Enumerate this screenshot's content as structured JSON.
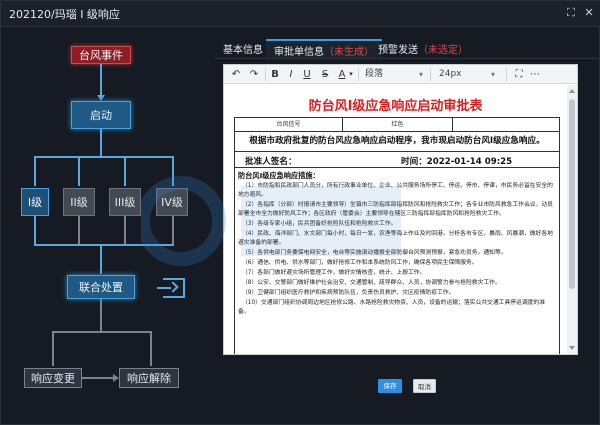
{
  "window": {
    "title": "202120/玛瑙 I 级响应"
  },
  "flow": {
    "event": "台风事件",
    "start": "启动",
    "levels": [
      "I级",
      "II级",
      "III级",
      "IV级"
    ],
    "joint": "联合处置",
    "change": "响应变更",
    "release": "响应解除"
  },
  "tabs": [
    {
      "label": "基本信息",
      "suffix": ""
    },
    {
      "label": "审批单信息",
      "suffix": "（未生成）"
    },
    {
      "label": "预警发送",
      "suffix": "（未选定）"
    }
  ],
  "toolbar": {
    "undo": "↶",
    "redo": "↷",
    "bold": "B",
    "italic": "I",
    "underline": "U",
    "strike": "S",
    "color": "A",
    "paragraph": "段落",
    "fontsize": "24px"
  },
  "doc": {
    "title": "防台风Ⅰ级应急响应启动审批表",
    "level_label": "台风信号",
    "level_value": "红色",
    "request_text": "根据市政府批复的防台风应急响应启动程序，我市现启动防台风Ⅰ级应急响应。",
    "sign_label": "批准人签名：",
    "time_label": "时间：2022-01-14 09:25",
    "measures_head": "防台风Ⅰ级应急响应措施：",
    "measures": [
      "（1）市防指和民政部门人员分，所有行政事业单位、企业、公共服务场所停工、停运、停市、停课，市民务必留在安全的地方避风。",
      "（2）各指挥（分部）时报请市主要领导）坐镇市三防指挥部指挥防风和抢险救灾工作；各专业市防风救急工作会议，动员部署全市全力做好防风工作；各区政府（管委会）主要领导在辖区三防指挥部指挥防风和抢险救灾工作。",
      "（3）各级专家小组，民兵团备好抢险队伍和抢险救灾工作。",
      "（4）民政、海洋部门、水文部门每小时，每日一发，农渔等海上作业及时回港，分析各市专区，暴雨、风暴潮，做好各地避灾准备的部署。",
      "（5）各供电部门务要保电网安全，电台等实施滚动播报全部防御台风预测预报，紧急劝员务。通知等。",
      "（6）通信、供电、供水等部门，做好抢修工作和本系统防风工作，确保各项民生保障服务。",
      "（7）各部门做好避灾场所管理工作，做好灾情核查，统计、上报工作。",
      "（8）公安、交警部门做好维护社会治安、交通管制、疏导群众、人员，协调警力参与抢险救灾工作。",
      "（9）卫健部门组织医疗救护和疾病预防队伍，负责伤员救护、灾区疫情防疫工作。",
      "（10）交通部门组织协调周边地区抢修公路、水路抢险救灾物资、人员，设备的运输；落实公共交通工具停运调度的准备。"
    ]
  },
  "buttons": {
    "save": "保存",
    "cancel": "取消"
  },
  "colors": {
    "accent": "#2c8fe4",
    "danger": "#d81e1e",
    "node_blue": "#1f5a86",
    "node_red": "#8d1f24"
  }
}
